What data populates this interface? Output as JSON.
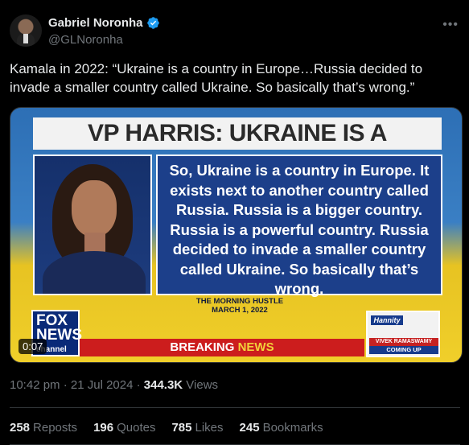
{
  "author": {
    "display_name": "Gabriel Noronha",
    "handle": "@GLNoronha",
    "verified": true,
    "verified_color": "#1d9bf0"
  },
  "more_icon": "more-horizontal-icon",
  "tweet": {
    "text": "Kamala in 2022: “Ukraine is a country in Europe…Russia decided to invade a smaller country called Ukraine. So basically that’s wrong.”"
  },
  "video": {
    "banner_title": "VP HARRIS: UKRAINE IS A COUNTRY",
    "quote": "So, Ukraine is a country in Europe. It exists next to another country called Russia. Russia is a bigger country. Russia is a powerful country. Russia decided to invade a smaller country called Ukraine. So basically that’s wrong.",
    "source_line1": "THE MORNING HUSTLE",
    "source_line2": "MARCH 1, 2022",
    "logo_line1": "FOX",
    "logo_line2": "NEWS",
    "logo_line3": "channel",
    "breaking_part1": "BREAKING ",
    "breaking_part2": "NEWS",
    "show_name": "Hannity",
    "guest_name": "VIVEK RAMASWAMY",
    "coming_up": "COMING UP",
    "duration": "0:07"
  },
  "meta": {
    "time": "10:42 pm · 21 Jul 2024 · ",
    "views_count": "344.3K",
    "views_label": " Views"
  },
  "stats": [
    {
      "count": "258",
      "label": "Reposts"
    },
    {
      "count": "196",
      "label": "Quotes"
    },
    {
      "count": "785",
      "label": "Likes"
    },
    {
      "count": "245",
      "label": "Bookmarks"
    }
  ]
}
